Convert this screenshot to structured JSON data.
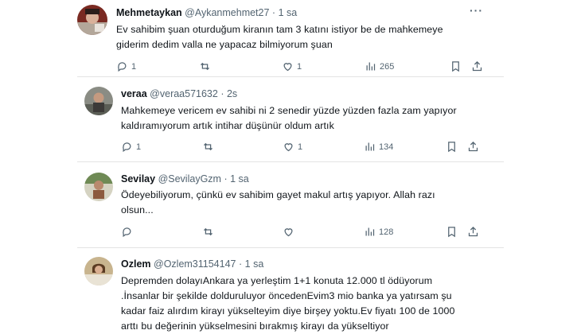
{
  "tweets": [
    {
      "name": "Mehmetaykan",
      "handle": "@Aykanmehmet27",
      "separator": "·",
      "time": "1 sa",
      "text_lines": [
        "Ev sahibim şuan oturduğum kiranın tam 3 katını istiyor be de  mahkemeye",
        "giderim dedim valla ne yapacaz bilmiyorum şuan"
      ],
      "replies": "1",
      "retweets": "",
      "likes": "1",
      "views": "265"
    },
    {
      "name": "veraa",
      "handle": "@veraa571632",
      "separator": "·",
      "time": "2s",
      "text_lines": [
        "Mahkemeye vericem ev sahibi ni 2 senedir yüzde yüzden fazla zam yapıyor",
        "kaldıramıyorum artık intihar düşünür oldum artık"
      ],
      "replies": "1",
      "retweets": "",
      "likes": "1",
      "views": "134"
    },
    {
      "name": "Sevilay",
      "handle": "@SevilayGzm",
      "separator": "·",
      "time": "1 sa",
      "text_lines": [
        "Ödeyebiliyorum, çünkü ev sahibim gayet makul artış yapıyor. Allah razı",
        "olsun..."
      ],
      "replies": "",
      "retweets": "",
      "likes": "",
      "views": "128"
    },
    {
      "name": "Ozlem",
      "handle": "@Ozlem31154147",
      "separator": "·",
      "time": "1 sa",
      "text_lines": [
        "Depremden dolayıAnkara ya yerleştim 1+1 konuta 12.000 tl ödüyorum",
        ".İnsanlar bir şekilde dolduruluyor öncedenEvim3 mio banka ya yatırsam şu",
        "kadar faiz alırdım kirayı yükselteyim diye birşey yoktu.Ev fiyatı 100 de 1000",
        "arttı bu değerinin yükselmesini bırakmış kirayı da yükseltiyor"
      ]
    }
  ],
  "icons": {
    "more": "more-horizontal-icon",
    "reply": "reply-icon",
    "retweet": "retweet-icon",
    "like": "heart-icon",
    "views": "views-chart-icon",
    "bookmark": "bookmark-icon",
    "share": "share-icon"
  },
  "more_glyph": "···"
}
